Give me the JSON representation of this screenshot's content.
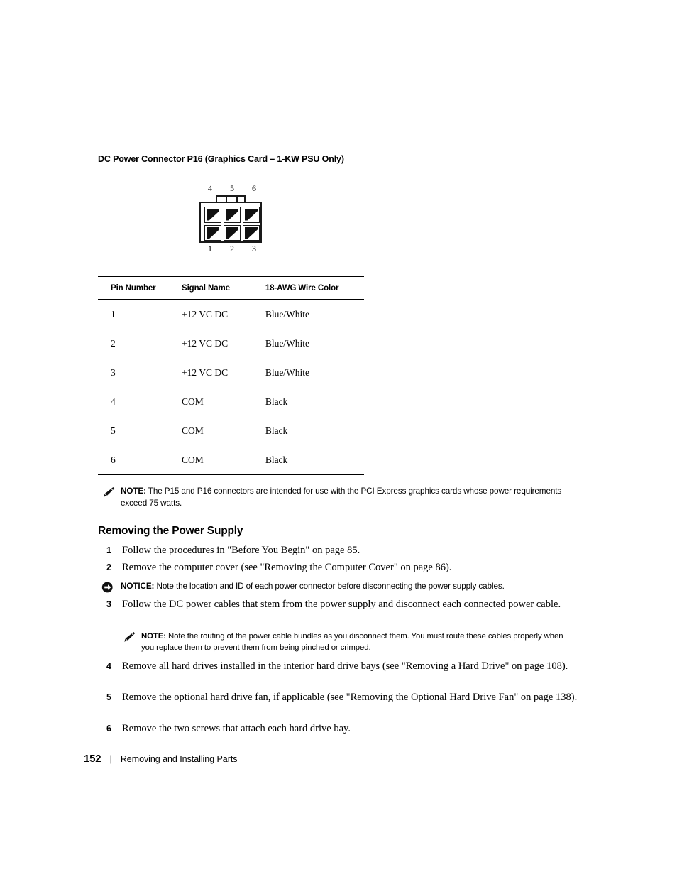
{
  "document": {
    "page_number": "152",
    "footer_separator": "|",
    "footer_title": "Removing and Installing Parts"
  },
  "connector_section": {
    "caption": "DC Power Connector P16 (Graphics Card – 1-KW PSU Only)",
    "diagram": {
      "icon_name": "six-pin-power-connector",
      "top_pin_labels": [
        "4",
        "5",
        "6"
      ],
      "bottom_pin_labels": [
        "1",
        "2",
        "3"
      ]
    }
  },
  "pinout_table": {
    "headers": [
      "Pin Number",
      "Signal Name",
      "18-AWG Wire Color"
    ],
    "rows": [
      {
        "pin": "1",
        "signal": "+12 VC DC",
        "wire_color": "Blue/White"
      },
      {
        "pin": "2",
        "signal": "+12 VC DC",
        "wire_color": "Blue/White"
      },
      {
        "pin": "3",
        "signal": "+12 VC DC",
        "wire_color": "Blue/White"
      },
      {
        "pin": "4",
        "signal": "COM",
        "wire_color": "Black"
      },
      {
        "pin": "5",
        "signal": "COM",
        "wire_color": "Black"
      },
      {
        "pin": "6",
        "signal": "COM",
        "wire_color": "Black"
      }
    ]
  },
  "callouts": {
    "note_1": {
      "icon_name": "pencil-icon",
      "label": "NOTE:",
      "text": " The P15 and P16 connectors are intended for use with the PCI Express graphics cards whose power requirements exceed 75 watts."
    },
    "notice_1": {
      "icon_name": "arrow-circle-icon",
      "label": "NOTICE:",
      "text": " Note the location and ID of each power connector before disconnecting the power supply cables."
    },
    "note_2": {
      "icon_name": "pencil-icon",
      "label": "NOTE:",
      "text": " Note the routing of the power cable bundles as you disconnect them. You must route these cables properly when you replace them to prevent them from being pinched or crimped."
    }
  },
  "procedure": {
    "heading": "Removing the Power Supply",
    "steps": [
      {
        "number": "1",
        "text": "Follow the procedures in \"Before You Begin\" on page 85."
      },
      {
        "number": "2",
        "text": "Remove the computer cover (see \"Removing the Computer Cover\" on page 86)."
      },
      {
        "number": "3",
        "text": "Follow the DC power cables that stem from the power supply and disconnect each connected power cable."
      },
      {
        "number": "4",
        "text": "Remove all hard drives installed in the interior hard drive bays (see \"Removing a Hard Drive\" on page 108)."
      },
      {
        "number": "5",
        "text": "Remove the optional hard drive fan, if applicable (see \"Removing the Optional Hard Drive Fan\" on page 138)."
      },
      {
        "number": "6",
        "text": "Remove the two screws that attach each hard drive bay."
      }
    ]
  },
  "colors": {
    "ink": "#000000",
    "page_background": "#ffffff",
    "rule": "#000000"
  }
}
